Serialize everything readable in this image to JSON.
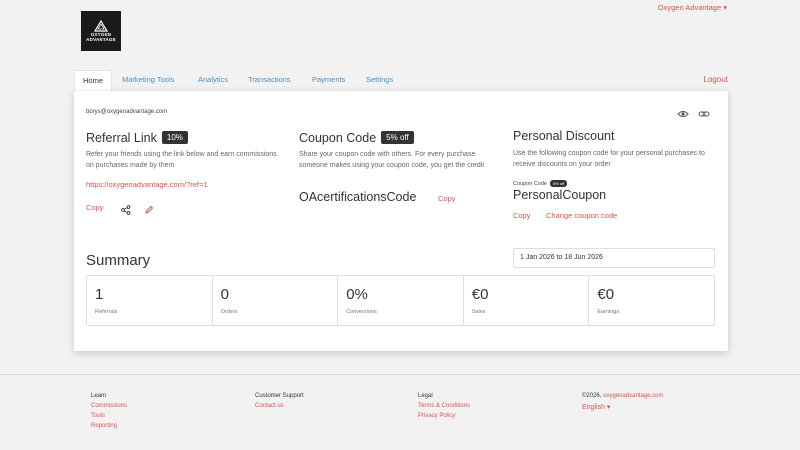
{
  "header": {
    "account_menu": "Oxygen Advantage ▾",
    "logo_line1": "OXYGEN",
    "logo_line2": "ADVANTAGE"
  },
  "nav": {
    "tabs": [
      "Home",
      "Marketing Tools",
      "Analytics",
      "Transactions",
      "Payments",
      "Settings"
    ],
    "logout": "Logout"
  },
  "account": {
    "email": "borys@oxygenadvantage.com"
  },
  "referral": {
    "title": "Referral Link",
    "badge": "10%",
    "description": "Refer your friends using the link below and earn commissions on purchases made by them",
    "link": "https://oxygenadvantage.com/?ref=1",
    "copy": "Copy"
  },
  "coupon": {
    "title": "Coupon Code",
    "badge": "5% off",
    "description": "Share your coupon code with others. For every purchase someone makes using your coupon code, you get the credit",
    "code": "OAcertificationsCode",
    "copy": "Copy"
  },
  "discount": {
    "title": "Personal Discount",
    "description": "Use the following coupon code for your personal purchases to receive discounts on your order",
    "code_label": "Coupon Code",
    "code_badge": "5% off",
    "code": "PersonalCoupon",
    "copy": "Copy",
    "change": "Change coupon code"
  },
  "summary": {
    "title": "Summary",
    "date_range": "1 Jan 2026 to 18 Jun 2026",
    "stats": [
      {
        "value": "1",
        "label": "Referrals"
      },
      {
        "value": "0",
        "label": "Orders"
      },
      {
        "value": "0%",
        "label": "Conversions"
      },
      {
        "value": "€0",
        "label": "Sales"
      },
      {
        "value": "€0",
        "label": "Earnings"
      }
    ]
  },
  "footer": {
    "learn": {
      "title": "Learn",
      "links": [
        "Commissions",
        "Tools",
        "Reporting"
      ]
    },
    "support": {
      "title": "Customer Support",
      "links": [
        "Contact us"
      ]
    },
    "legal": {
      "title": "Legal",
      "links": [
        "Terms & Conditions",
        "Privacy Policy"
      ]
    },
    "copyright_prefix": "©2026,",
    "copyright_link": "oxygenadvantage.com",
    "language": "English ▾"
  },
  "colors": {
    "accent": "#d9534f",
    "nav_link": "#4a90c4",
    "badge_bg": "#333333"
  }
}
